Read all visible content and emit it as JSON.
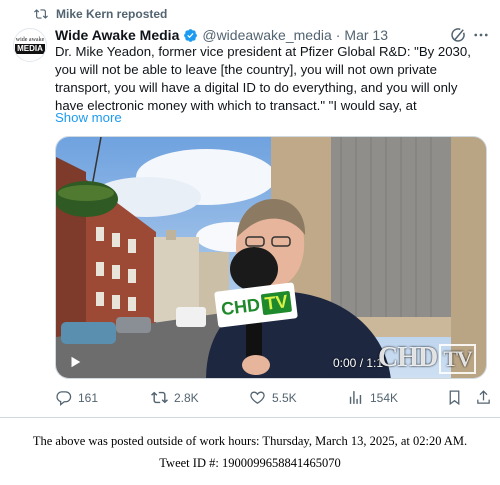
{
  "repost": {
    "label": "Mike Kern reposted",
    "icon": "repost-icon"
  },
  "author": {
    "avatar_top": "wide awake",
    "avatar_bottom": "MEDIA",
    "name": "Wide Awake Media",
    "handle": "@wideawake_media",
    "separator": "·",
    "date": "Mar 13",
    "verified_color": "#1d9bf0"
  },
  "tweet": {
    "text": "Dr. Mike Yeadon, former vice president at Pfizer Global R&D: \"By 2030, you will not be able to leave [the country], you will not own private transport, you will have a digital ID to do everything, and you will only have electronic money with which to transact.\" \"I would say, at",
    "show_more": "Show more"
  },
  "video": {
    "time": "0:00 / 1:1",
    "watermark": "CHD",
    "watermark_tv": "TV",
    "mic_label": "CHD",
    "mic_label_tv": "TV"
  },
  "actions": {
    "replies": "161",
    "reposts": "2.8K",
    "likes": "5.5K",
    "views": "154K"
  },
  "footer": {
    "line1": "The above was posted outside of work hours: Thursday, March 13, 2025, at 02:20 AM.",
    "line2": "Tweet ID #: 1900099658841465070"
  },
  "colors": {
    "accent": "#1d9bf0",
    "muted": "#536471",
    "text": "#0f1419"
  }
}
